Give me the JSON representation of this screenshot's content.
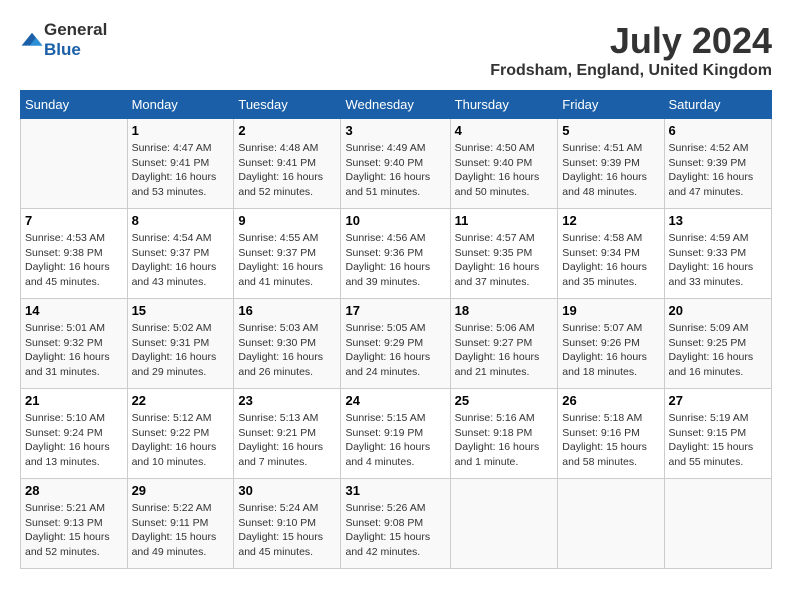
{
  "logo": {
    "general": "General",
    "blue": "Blue"
  },
  "title": {
    "month_year": "July 2024",
    "location": "Frodsham, England, United Kingdom"
  },
  "calendar": {
    "headers": [
      "Sunday",
      "Monday",
      "Tuesday",
      "Wednesday",
      "Thursday",
      "Friday",
      "Saturday"
    ],
    "weeks": [
      [
        {
          "day": "",
          "content": ""
        },
        {
          "day": "1",
          "content": "Sunrise: 4:47 AM\nSunset: 9:41 PM\nDaylight: 16 hours\nand 53 minutes."
        },
        {
          "day": "2",
          "content": "Sunrise: 4:48 AM\nSunset: 9:41 PM\nDaylight: 16 hours\nand 52 minutes."
        },
        {
          "day": "3",
          "content": "Sunrise: 4:49 AM\nSunset: 9:40 PM\nDaylight: 16 hours\nand 51 minutes."
        },
        {
          "day": "4",
          "content": "Sunrise: 4:50 AM\nSunset: 9:40 PM\nDaylight: 16 hours\nand 50 minutes."
        },
        {
          "day": "5",
          "content": "Sunrise: 4:51 AM\nSunset: 9:39 PM\nDaylight: 16 hours\nand 48 minutes."
        },
        {
          "day": "6",
          "content": "Sunrise: 4:52 AM\nSunset: 9:39 PM\nDaylight: 16 hours\nand 47 minutes."
        }
      ],
      [
        {
          "day": "7",
          "content": "Sunrise: 4:53 AM\nSunset: 9:38 PM\nDaylight: 16 hours\nand 45 minutes."
        },
        {
          "day": "8",
          "content": "Sunrise: 4:54 AM\nSunset: 9:37 PM\nDaylight: 16 hours\nand 43 minutes."
        },
        {
          "day": "9",
          "content": "Sunrise: 4:55 AM\nSunset: 9:37 PM\nDaylight: 16 hours\nand 41 minutes."
        },
        {
          "day": "10",
          "content": "Sunrise: 4:56 AM\nSunset: 9:36 PM\nDaylight: 16 hours\nand 39 minutes."
        },
        {
          "day": "11",
          "content": "Sunrise: 4:57 AM\nSunset: 9:35 PM\nDaylight: 16 hours\nand 37 minutes."
        },
        {
          "day": "12",
          "content": "Sunrise: 4:58 AM\nSunset: 9:34 PM\nDaylight: 16 hours\nand 35 minutes."
        },
        {
          "day": "13",
          "content": "Sunrise: 4:59 AM\nSunset: 9:33 PM\nDaylight: 16 hours\nand 33 minutes."
        }
      ],
      [
        {
          "day": "14",
          "content": "Sunrise: 5:01 AM\nSunset: 9:32 PM\nDaylight: 16 hours\nand 31 minutes."
        },
        {
          "day": "15",
          "content": "Sunrise: 5:02 AM\nSunset: 9:31 PM\nDaylight: 16 hours\nand 29 minutes."
        },
        {
          "day": "16",
          "content": "Sunrise: 5:03 AM\nSunset: 9:30 PM\nDaylight: 16 hours\nand 26 minutes."
        },
        {
          "day": "17",
          "content": "Sunrise: 5:05 AM\nSunset: 9:29 PM\nDaylight: 16 hours\nand 24 minutes."
        },
        {
          "day": "18",
          "content": "Sunrise: 5:06 AM\nSunset: 9:27 PM\nDaylight: 16 hours\nand 21 minutes."
        },
        {
          "day": "19",
          "content": "Sunrise: 5:07 AM\nSunset: 9:26 PM\nDaylight: 16 hours\nand 18 minutes."
        },
        {
          "day": "20",
          "content": "Sunrise: 5:09 AM\nSunset: 9:25 PM\nDaylight: 16 hours\nand 16 minutes."
        }
      ],
      [
        {
          "day": "21",
          "content": "Sunrise: 5:10 AM\nSunset: 9:24 PM\nDaylight: 16 hours\nand 13 minutes."
        },
        {
          "day": "22",
          "content": "Sunrise: 5:12 AM\nSunset: 9:22 PM\nDaylight: 16 hours\nand 10 minutes."
        },
        {
          "day": "23",
          "content": "Sunrise: 5:13 AM\nSunset: 9:21 PM\nDaylight: 16 hours\nand 7 minutes."
        },
        {
          "day": "24",
          "content": "Sunrise: 5:15 AM\nSunset: 9:19 PM\nDaylight: 16 hours\nand 4 minutes."
        },
        {
          "day": "25",
          "content": "Sunrise: 5:16 AM\nSunset: 9:18 PM\nDaylight: 16 hours\nand 1 minute."
        },
        {
          "day": "26",
          "content": "Sunrise: 5:18 AM\nSunset: 9:16 PM\nDaylight: 15 hours\nand 58 minutes."
        },
        {
          "day": "27",
          "content": "Sunrise: 5:19 AM\nSunset: 9:15 PM\nDaylight: 15 hours\nand 55 minutes."
        }
      ],
      [
        {
          "day": "28",
          "content": "Sunrise: 5:21 AM\nSunset: 9:13 PM\nDaylight: 15 hours\nand 52 minutes."
        },
        {
          "day": "29",
          "content": "Sunrise: 5:22 AM\nSunset: 9:11 PM\nDaylight: 15 hours\nand 49 minutes."
        },
        {
          "day": "30",
          "content": "Sunrise: 5:24 AM\nSunset: 9:10 PM\nDaylight: 15 hours\nand 45 minutes."
        },
        {
          "day": "31",
          "content": "Sunrise: 5:26 AM\nSunset: 9:08 PM\nDaylight: 15 hours\nand 42 minutes."
        },
        {
          "day": "",
          "content": ""
        },
        {
          "day": "",
          "content": ""
        },
        {
          "day": "",
          "content": ""
        }
      ]
    ]
  }
}
